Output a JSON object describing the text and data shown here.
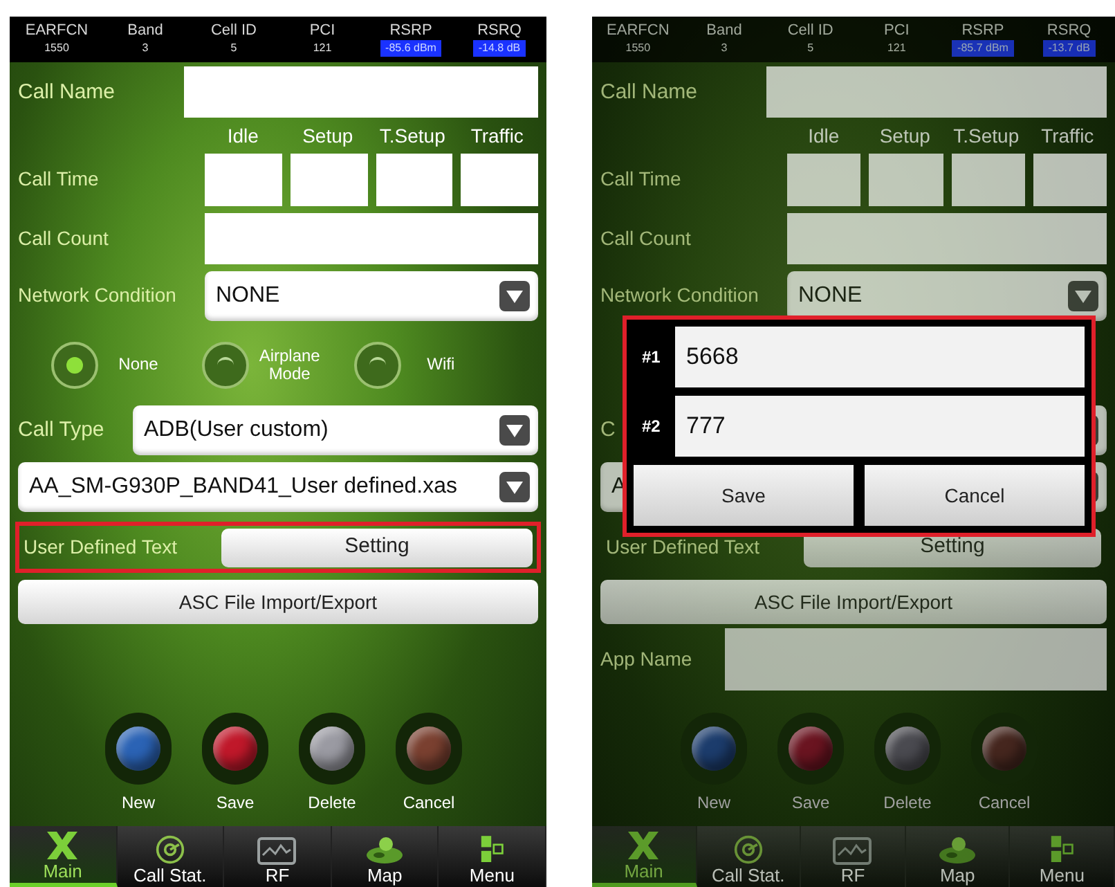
{
  "screens": [
    {
      "dimmed": false,
      "header": [
        {
          "label": "EARFCN",
          "value": "1550",
          "highlight": false
        },
        {
          "label": "Band",
          "value": "3",
          "highlight": false
        },
        {
          "label": "Cell ID",
          "value": "5",
          "highlight": false
        },
        {
          "label": "PCI",
          "value": "121",
          "highlight": false
        },
        {
          "label": "RSRP",
          "value": "-85.6 dBm",
          "highlight": true
        },
        {
          "label": "RSRQ",
          "value": "-14.8 dB",
          "highlight": true
        }
      ],
      "call_name": {
        "label": "Call Name"
      },
      "call_time": {
        "label": "Call Time",
        "columns": [
          "Idle",
          "Setup",
          "T.Setup",
          "Traffic"
        ]
      },
      "call_count": {
        "label": "Call Count"
      },
      "network_condition": {
        "label": "Network Condition",
        "value": "NONE"
      },
      "radios": [
        {
          "label": "None",
          "selected": true
        },
        {
          "label": "Airplane Mode",
          "selected": false
        },
        {
          "label": "Wifi",
          "selected": false
        }
      ],
      "call_type": {
        "label": "Call Type",
        "value": "ADB(User custom)"
      },
      "script_file": {
        "value": "AA_SM-G930P_BAND41_User defined.xas"
      },
      "user_defined_text": {
        "label": "User Defined Text",
        "button": "Setting",
        "highlighted": true
      },
      "asc_button": "ASC File Import/Export",
      "actions": [
        {
          "label": "New",
          "color": "#2b63b5"
        },
        {
          "label": "Save",
          "color": "#c0182a"
        },
        {
          "label": "Delete",
          "color": "#9a9aa2"
        },
        {
          "label": "Cancel",
          "color": "#7a4030"
        }
      ],
      "tabs": [
        {
          "label": "Main",
          "selected": true
        },
        {
          "label": "Call Stat.",
          "selected": false
        },
        {
          "label": "RF",
          "selected": false
        },
        {
          "label": "Map",
          "selected": false
        },
        {
          "label": "Menu",
          "selected": false
        }
      ]
    },
    {
      "dimmed": true,
      "header": [
        {
          "label": "EARFCN",
          "value": "1550",
          "highlight": false
        },
        {
          "label": "Band",
          "value": "3",
          "highlight": false
        },
        {
          "label": "Cell ID",
          "value": "5",
          "highlight": false
        },
        {
          "label": "PCI",
          "value": "121",
          "highlight": false
        },
        {
          "label": "RSRP",
          "value": "-85.7 dBm",
          "highlight": true
        },
        {
          "label": "RSRQ",
          "value": "-13.7 dB",
          "highlight": true
        }
      ],
      "call_name": {
        "label": "Call Name"
      },
      "call_time": {
        "label": "Call Time",
        "columns": [
          "Idle",
          "Setup",
          "T.Setup",
          "Traffic"
        ]
      },
      "call_count": {
        "label": "Call Count"
      },
      "network_condition": {
        "label": "Network Condition",
        "value": "NONE"
      },
      "call_type": {
        "label": "C"
      },
      "script_file": {
        "value": "A"
      },
      "user_defined_text": {
        "label": "User Defined Text",
        "button": "Setting",
        "highlighted": false
      },
      "asc_button": "ASC File Import/Export",
      "app_name": {
        "label": "App Name"
      },
      "actions": [
        {
          "label": "New",
          "color": "#1c3c6c"
        },
        {
          "label": "Save",
          "color": "#6a1420"
        },
        {
          "label": "Delete",
          "color": "#4a4a50"
        },
        {
          "label": "Cancel",
          "color": "#45261e"
        }
      ],
      "tabs": [
        {
          "label": "Main",
          "selected": true
        },
        {
          "label": "Call Stat.",
          "selected": false
        },
        {
          "label": "RF",
          "selected": false
        },
        {
          "label": "Map",
          "selected": false
        },
        {
          "label": "Menu",
          "selected": false
        }
      ],
      "dialog": {
        "highlighted": true,
        "fields": [
          {
            "label": "#1",
            "value": "5668"
          },
          {
            "label": "#2",
            "value": "777"
          }
        ],
        "buttons": [
          "Save",
          "Cancel"
        ]
      }
    }
  ]
}
